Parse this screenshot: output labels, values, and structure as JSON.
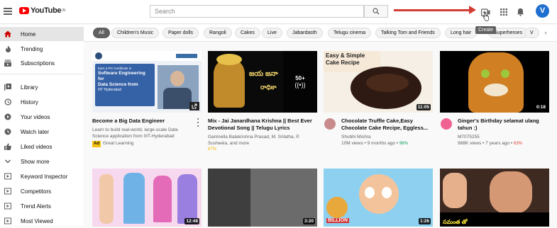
{
  "header": {
    "logo_text": "YouTube",
    "logo_region": "IN",
    "search_placeholder": "Search",
    "avatar_letter": "V",
    "tooltip": "Create",
    "colors": {
      "brand": "#ff0000",
      "arrow": "#d23b33",
      "avatar": "#1e6fcf"
    }
  },
  "sidebar": {
    "items": [
      {
        "label": "Home",
        "icon": "home-icon"
      },
      {
        "label": "Trending",
        "icon": "flame-icon"
      },
      {
        "label": "Subscriptions",
        "icon": "subscriptions-icon"
      },
      {
        "label": "Library",
        "icon": "library-icon"
      },
      {
        "label": "History",
        "icon": "history-icon"
      },
      {
        "label": "Your videos",
        "icon": "your-videos-icon"
      },
      {
        "label": "Watch later",
        "icon": "clock-icon"
      },
      {
        "label": "Liked videos",
        "icon": "thumbs-up-icon"
      },
      {
        "label": "Show more",
        "icon": "chevron-down-icon"
      },
      {
        "label": "Keyword Inspector",
        "icon": "playlist-icon"
      },
      {
        "label": "Competitors",
        "icon": "playlist-icon"
      },
      {
        "label": "Trend Alerts",
        "icon": "playlist-icon"
      },
      {
        "label": "Most Viewed",
        "icon": "playlist-icon"
      }
    ]
  },
  "chips": [
    "All",
    "Children's Music",
    "Paper dolls",
    "Rangoli",
    "Cakes",
    "Live",
    "Jabardasth",
    "Telugu cinema",
    "Talking Tom and Friends",
    "Long hair",
    "Superheroes",
    "V"
  ],
  "videos": [
    {
      "title": "Become a Big Data Engineer",
      "description": "Learn to build real-world, large-scale Data Science application from IIIT-Hyderabad",
      "ad_label": "Ad",
      "channel": "Great Learning",
      "thumb_text": [
        "Earn a PG Certificate in",
        "Software Engineering for",
        "Data Science from",
        "IIIT Hyderabad"
      ]
    },
    {
      "title": "Mix - Jai Janardhana Krishna || Best Ever Devotional Song || Telugu Lyrics",
      "channel": "Garimella Balakrishna Prasad, M. Srilatha, P. Susheela, and more",
      "overlay": "50+",
      "thumb_text": [
        "జయ జనా",
        "రాధికా"
      ]
    },
    {
      "title": "Chocolate Truffle Cake,Easy Chocolate Cake Recipe, Eggless...",
      "channel": "Shubhi Mishra",
      "views": "10M views",
      "age": "9 months ago",
      "trend": "96%",
      "duration": "11:05",
      "thumb_text": [
        "Easy & Simple",
        "Cake Recipe"
      ]
    },
    {
      "title": "Ginger's Birthday selamat ulang tahun :)",
      "channel": "M7075255",
      "views": "988K views",
      "age": "7 years ago",
      "trend": "63%",
      "duration": "0:18"
    },
    {
      "duration": "12:48"
    },
    {
      "duration": "3:20"
    },
    {
      "duration": "1:26",
      "thumb_text": [
        "BILLION"
      ]
    },
    {
      "duration": "",
      "thumb_text": [
        "సమంత తో"
      ]
    }
  ]
}
